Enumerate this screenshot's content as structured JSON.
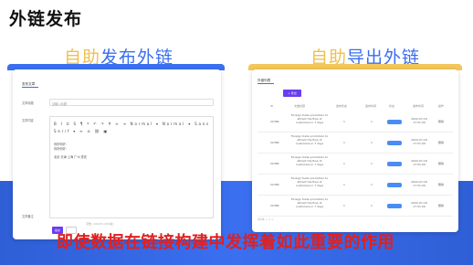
{
  "slide": {
    "title": "外链发布",
    "subtitle": "即使数据在链接构建中发挥着如此重要的作用"
  },
  "left_section": {
    "title_accent": "自助",
    "title_rest": "发布外链",
    "tab": "发布文章",
    "fields": [
      {
        "label": "文章标题",
        "value": "请输入标题"
      },
      {
        "label": "文章内容"
      }
    ],
    "toolbar": "B I U S ¶ ❝ ↶ ↷ 𝐓 ≡ ⇥ Normal ▾  Normal ▾  Sans Serif ▾  ≡ ⊘ ⛓ ▣",
    "editor_lines": [
      "你好你好：",
      "你好你好：",
      "",
      "北京   天津   上海   广州  重庆"
    ],
    "extra_label": "文章备注",
    "counter": "字数: 100/70 (200级)",
    "submit": "提交"
  },
  "right_section": {
    "title_accent": "自助",
    "title_rest": "导出外链",
    "tab": "外链列表",
    "export_button": "+ 导出",
    "columns": [
      "ID",
      "文章标题",
      "发布状态",
      "发布时间",
      "状态",
      "发布时间",
      "操作"
    ],
    "rows": [
      {
        "id": "22386",
        "title": "Foreign trade promotion to attract the flow of customers in 7 days",
        "c1": "1",
        "c2": "1",
        "date": "2022-07-18 17:51:09",
        "op": "删除"
      },
      {
        "id": "22386",
        "title": "Foreign trade promotion to attract the flow of customers in 7 days",
        "c1": "1",
        "c2": "1",
        "date": "2022-07-18 17:51:09",
        "op": "删除"
      },
      {
        "id": "22386",
        "title": "Foreign trade promotion to attract the flow of customers in 7 days",
        "c1": "1",
        "c2": "1",
        "date": "2022-07-18 17:51:09",
        "op": "删除"
      },
      {
        "id": "22386",
        "title": "Foreign trade promotion to attract the flow of customers in 7 days",
        "c1": "1",
        "c2": "1",
        "date": "2022-07-18 17:51:09",
        "op": "删除"
      },
      {
        "id": "22386",
        "title": "Foreign trade promotion to attract the flow of customers in 7 days",
        "c1": "1",
        "c2": "1",
        "date": "2022-07-18 17:51:09",
        "op": "删除"
      }
    ],
    "pager": "共5条  < 1 >"
  },
  "colors": {
    "accent_blue": "#3a6ff0",
    "accent_gold": "#f0c050",
    "purple_button": "#6a3cf0",
    "subtitle_red": "#e02020"
  }
}
